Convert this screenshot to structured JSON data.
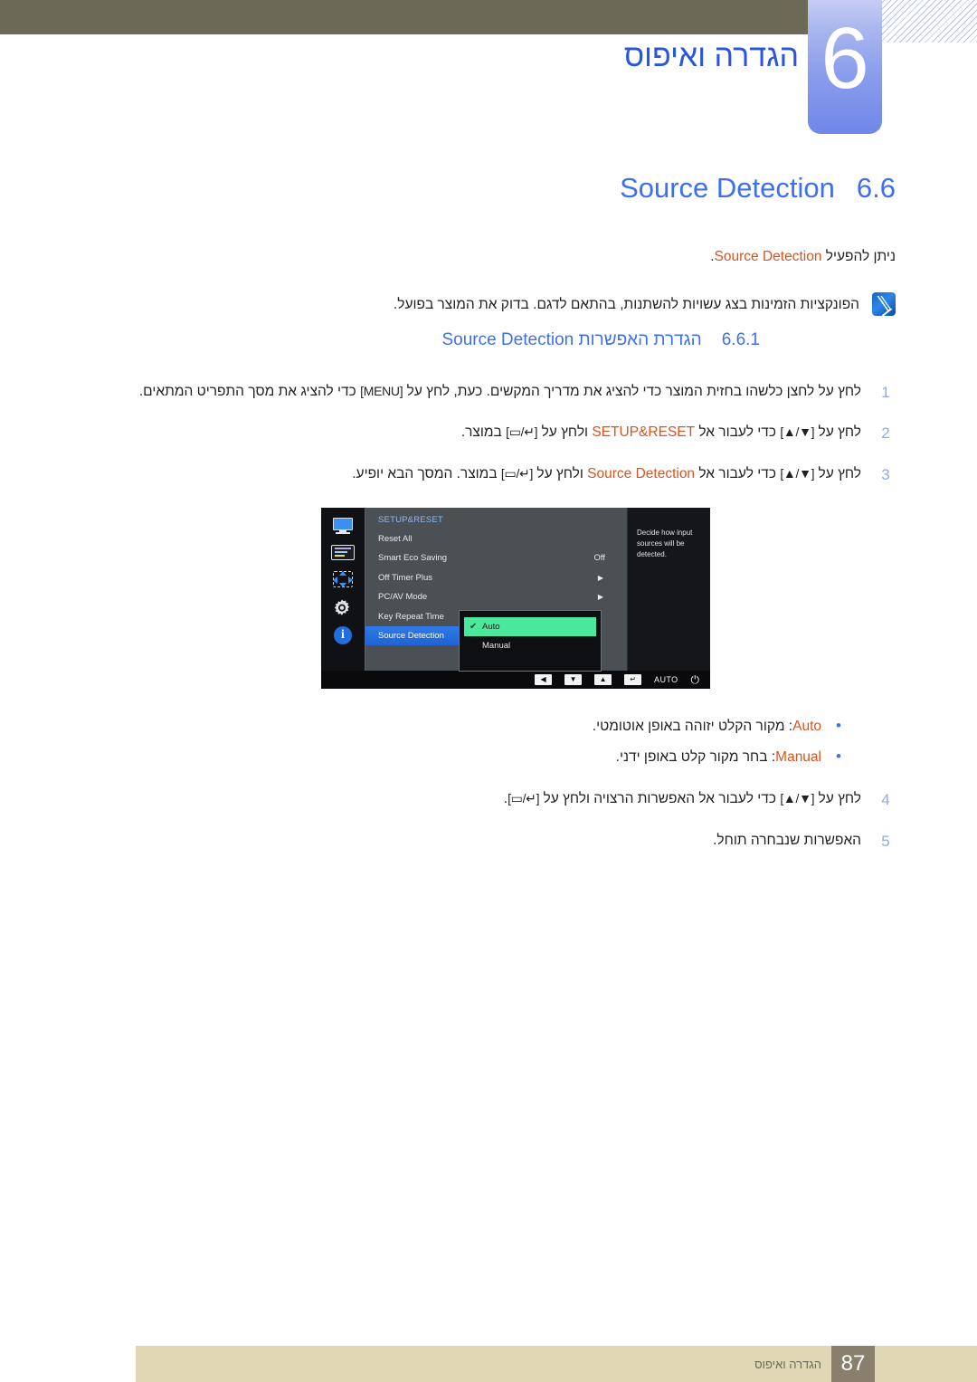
{
  "chapter": {
    "number": "6",
    "title": "הגדרה ואיפוס"
  },
  "section": {
    "number": "6.6",
    "title_en": "Source Detection",
    "lead_prefix": "ניתן להפעיל ",
    "lead_en": "Source Detection",
    "lead_suffix": "."
  },
  "note": {
    "icon": "samsung-note-icon",
    "text": "הפונקציות הזמינות בצג עשויות להשתנות, בהתאם לדגם. בדוק את המוצר בפועל."
  },
  "subsection": {
    "number": "6.6.1",
    "title_he": "הגדרת האפשרות ",
    "title_en": "Source Detection"
  },
  "steps": [
    {
      "num": "1",
      "parts": [
        {
          "type": "he",
          "text": "לחץ על לחצן כלשהו בחזית המוצר כדי להציג את מדריך המקשים. כעת, לחץ על "
        },
        {
          "type": "keycap",
          "text": "[MENU]"
        },
        {
          "type": "he",
          "text": " כדי להציג את מסך התפריט המתאים."
        }
      ]
    },
    {
      "num": "2",
      "parts": [
        {
          "type": "he",
          "text": "לחץ על "
        },
        {
          "type": "keycap",
          "text": "[▲/▼]"
        },
        {
          "type": "he",
          "text": " כדי לעבור אל "
        },
        {
          "type": "orange",
          "text": "SETUP&RESET"
        },
        {
          "type": "he",
          "text": " ולחץ על "
        },
        {
          "type": "keycap",
          "text": "[▭/↵]"
        },
        {
          "type": "he",
          "text": " במוצר."
        }
      ]
    },
    {
      "num": "3",
      "parts": [
        {
          "type": "he",
          "text": "לחץ על "
        },
        {
          "type": "keycap",
          "text": "[▲/▼]"
        },
        {
          "type": "he",
          "text": " כדי לעבור אל "
        },
        {
          "type": "orange",
          "text": "Source Detection"
        },
        {
          "type": "he",
          "text": " ולחץ על "
        },
        {
          "type": "keycap",
          "text": "[▭/↵]"
        },
        {
          "type": "he",
          "text": " במוצר. המסך הבא יופיע."
        }
      ]
    }
  ],
  "steps_after": [
    {
      "num": "4",
      "parts": [
        {
          "type": "he",
          "text": "לחץ על "
        },
        {
          "type": "keycap",
          "text": "[▲/▼]"
        },
        {
          "type": "he",
          "text": " כדי לעבור אל האפשרות הרצויה ולחץ על "
        },
        {
          "type": "keycap",
          "text": "[▭/↵]"
        },
        {
          "type": "he",
          "text": "."
        }
      ]
    },
    {
      "num": "5",
      "parts": [
        {
          "type": "he",
          "text": "האפשרות שנבחרה תוחל."
        }
      ]
    }
  ],
  "bullets": [
    {
      "option": "Auto",
      "text": ": מקור הקלט יזוהה באופן אוטומטי."
    },
    {
      "option": "Manual",
      "text": ": בחר מקור קלט באופן ידני."
    }
  ],
  "osd": {
    "menu_title": "SETUP&RESET",
    "sidebar_icons": [
      "monitor-icon",
      "picture-settings-icon",
      "position-arrows-icon",
      "gear-icon",
      "info-icon"
    ],
    "rows": [
      {
        "label": "Reset All",
        "value": "",
        "arrow": ""
      },
      {
        "label": "Smart Eco Saving",
        "value": "Off",
        "arrow": ""
      },
      {
        "label": "Off Timer Plus",
        "value": "",
        "arrow": "▶"
      },
      {
        "label": "PC/AV Mode",
        "value": "",
        "arrow": "▶"
      },
      {
        "label": "Key Repeat Time",
        "value": "",
        "arrow": ""
      },
      {
        "label": "Source Detection",
        "value": "",
        "arrow": "",
        "selected": true
      }
    ],
    "submenu": [
      {
        "label": "Auto",
        "checked": true,
        "highlight": true
      },
      {
        "label": "Manual",
        "checked": false,
        "highlight": false
      }
    ],
    "help_text": "Decide how input sources will be detected.",
    "bottom_buttons": [
      "◀",
      "▼",
      "▲",
      "↵",
      "AUTO",
      "⏻"
    ],
    "colors": {
      "selected_row": "#2f7ae8",
      "highlight": "#4ae89c",
      "panel": "#4b5055",
      "title": "#8fb8ef"
    }
  },
  "footer": {
    "page": "87",
    "label": "הגדרה ואיפוס"
  },
  "colors": {
    "heading_blue": "#3d6ff0",
    "accent_orange": "#d9531e",
    "olive": "#6c6a56",
    "footer_band": "#e0d8b4",
    "page_box": "#8a7f6c"
  }
}
